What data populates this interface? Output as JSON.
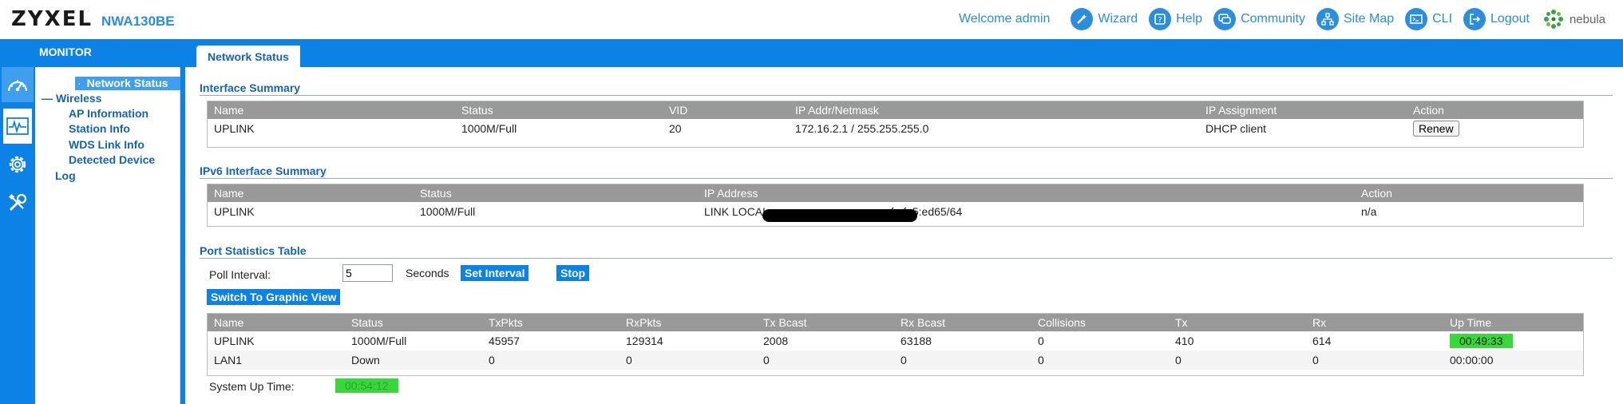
{
  "header": {
    "logo": "ZYXEL",
    "model": "NWA130BE",
    "welcome": "Welcome admin",
    "nav": [
      {
        "label": "Wizard",
        "icon": "wand-icon"
      },
      {
        "label": "Help",
        "icon": "help-icon"
      },
      {
        "label": "Community",
        "icon": "chat-icon"
      },
      {
        "label": "Site Map",
        "icon": "sitemap-icon"
      },
      {
        "label": "CLI",
        "icon": "cli-icon"
      },
      {
        "label": "Logout",
        "icon": "logout-icon"
      }
    ],
    "nebula": "nebula"
  },
  "sidebar": {
    "section": "MONITOR",
    "icons": [
      "dashboard-icon",
      "monitor-icon",
      "gear-icon",
      "maintenance-icon"
    ],
    "items": {
      "network_status": "Network Status",
      "wireless": "Wireless",
      "ap_information": "AP Information",
      "station_info": "Station Info",
      "wds_link_info": "WDS Link Info",
      "detected_device": "Detected Device",
      "log": "Log"
    }
  },
  "tab": "Network Status",
  "interface_summary": {
    "title": "Interface Summary",
    "columns": [
      "Name",
      "Status",
      "VID",
      "IP Addr/Netmask",
      "IP Assignment",
      "Action"
    ],
    "row": {
      "name": "UPLINK",
      "status": "1000M/Full",
      "vid": "20",
      "ip": "172.16.2.1 / 255.255.255.0",
      "assignment": "DHCP client",
      "action": "Renew"
    }
  },
  "ipv6_summary": {
    "title": "IPv6 Interface Summary",
    "columns": [
      "Name",
      "Status",
      "IP Address",
      "Action"
    ],
    "row": {
      "name": "UPLINK",
      "status": "1000M/Full",
      "ip": "LINK LOCAL --",
      "ip_tail": "fe:fe5:ed65/64",
      "action": "n/a"
    }
  },
  "port_stats": {
    "title": "Port Statistics Table",
    "poll_label": "Poll Interval:",
    "poll_value": "5",
    "seconds": "Seconds",
    "set_interval": "Set Interval",
    "stop": "Stop",
    "switch_view": "Switch To Graphic View",
    "columns": [
      "Name",
      "Status",
      "TxPkts",
      "RxPkts",
      "Tx Bcast",
      "Rx Bcast",
      "Collisions",
      "Tx",
      "Rx",
      "Up Time"
    ],
    "rows": [
      {
        "name": "UPLINK",
        "status": "1000M/Full",
        "txpkts": "45957",
        "rxpkts": "129314",
        "txbcast": "2008",
        "rxbcast": "63188",
        "collisions": "0",
        "tx": "410",
        "rx": "614",
        "uptime": "00:49:33"
      },
      {
        "name": "LAN1",
        "status": "Down",
        "txpkts": "0",
        "rxpkts": "0",
        "txbcast": "0",
        "rxbcast": "0",
        "collisions": "0",
        "tx": "0",
        "rx": "0",
        "uptime": "00:00:00"
      }
    ],
    "system_uptime_label": "System Up Time:",
    "system_uptime": "00:54:12"
  },
  "colors": {
    "brand": "#0c82e6",
    "link": "#1563b8",
    "highlight": "#39d63c"
  }
}
